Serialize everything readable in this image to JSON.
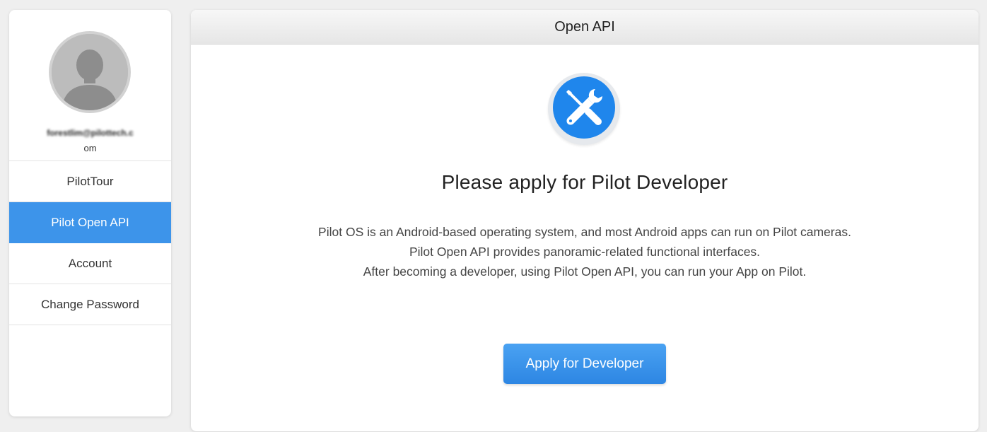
{
  "sidebar": {
    "user": {
      "email_line1": "forestlim@pilottech.c",
      "email_line2": "om"
    },
    "items": [
      {
        "label": "PilotTour",
        "active": false
      },
      {
        "label": "Pilot Open API",
        "active": true
      },
      {
        "label": "Account",
        "active": false
      },
      {
        "label": "Change Password",
        "active": false
      }
    ]
  },
  "main": {
    "title": "Open API",
    "icon": "tools-icon",
    "heading": "Please apply for Pilot Developer",
    "description": [
      "Pilot OS is an Android-based operating system, and most Android apps can run on Pilot cameras.",
      "Pilot Open API provides panoramic-related functional interfaces.",
      "After becoming a developer, using Pilot Open API, you can run your App on Pilot."
    ],
    "apply_button": "Apply for Developer"
  },
  "colors": {
    "accent": "#3d94ea",
    "icon_bg": "#1f86ec",
    "page_bg": "#efefef"
  }
}
